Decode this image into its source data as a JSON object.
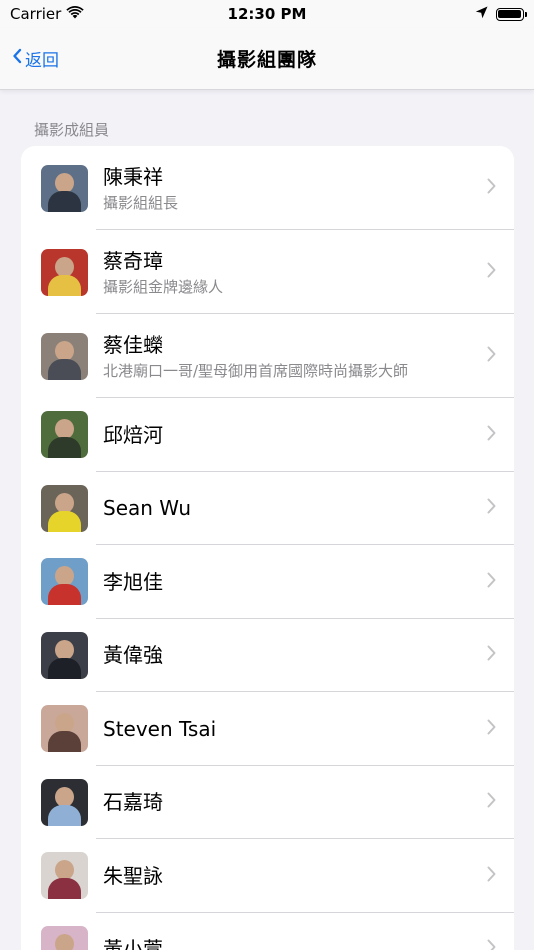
{
  "status_bar": {
    "carrier": "Carrier",
    "time": "12:30 PM"
  },
  "nav": {
    "back_label": "返回",
    "title": "攝影組團隊"
  },
  "section": {
    "header": "攝影成組員"
  },
  "members": [
    {
      "name": "陳秉祥",
      "subtitle": "攝影組組長",
      "bg": "#5d7087",
      "shirt": "#2b3440"
    },
    {
      "name": "蔡奇璋",
      "subtitle": "攝影組金牌邊緣人",
      "bg": "#b8362c",
      "shirt": "#e5c042"
    },
    {
      "name": "蔡佳蠑",
      "subtitle": "北港廟口一哥/聖母御用首席國際時尚攝影大師",
      "bg": "#8b8178",
      "shirt": "#4a4d55"
    },
    {
      "name": "邱焙河",
      "subtitle": "",
      "bg": "#4f6d3c",
      "shirt": "#2e3a2a"
    },
    {
      "name": "Sean Wu",
      "subtitle": "",
      "bg": "#6b6458",
      "shirt": "#e6d42a"
    },
    {
      "name": "李旭佳",
      "subtitle": "",
      "bg": "#6f9fc8",
      "shirt": "#c8322d"
    },
    {
      "name": "黃偉強",
      "subtitle": "",
      "bg": "#3d3f48",
      "shirt": "#1e2028"
    },
    {
      "name": "Steven Tsai",
      "subtitle": "",
      "bg": "#c9a89a",
      "shirt": "#5a4038"
    },
    {
      "name": "石嘉琦",
      "subtitle": "",
      "bg": "#2c2e33",
      "shirt": "#8fb0d4"
    },
    {
      "name": "朱聖詠",
      "subtitle": "",
      "bg": "#d9d4cf",
      "shirt": "#8a3040"
    },
    {
      "name": "黃小萱",
      "subtitle": "",
      "bg": "#d7b4c8",
      "shirt": "#7a8fc0"
    }
  ]
}
